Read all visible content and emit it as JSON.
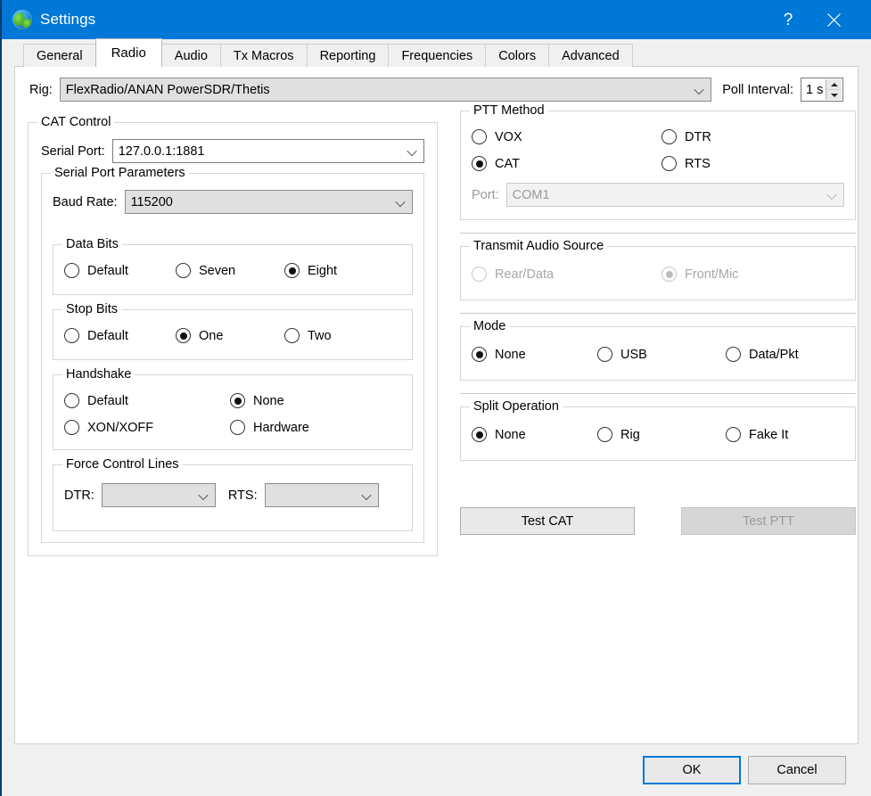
{
  "window": {
    "title": "Settings",
    "icon": "globe-icon",
    "help_label": "?",
    "close_label": "✕",
    "accent_color": "#0078d7"
  },
  "tabs": [
    {
      "label": "General",
      "active": false
    },
    {
      "label": "Radio",
      "active": true
    },
    {
      "label": "Audio",
      "active": false
    },
    {
      "label": "Tx Macros",
      "active": false
    },
    {
      "label": "Reporting",
      "active": false
    },
    {
      "label": "Frequencies",
      "active": false
    },
    {
      "label": "Colors",
      "active": false
    },
    {
      "label": "Advanced",
      "active": false
    }
  ],
  "rig": {
    "label": "Rig:",
    "value": "FlexRadio/ANAN PowerSDR/Thetis",
    "poll_label": "Poll Interval:",
    "poll_value": "1 s"
  },
  "cat_control": {
    "legend": "CAT Control",
    "serial_port": {
      "label": "Serial Port:",
      "value": "127.0.0.1:1881"
    },
    "serial_params": {
      "legend": "Serial Port Parameters",
      "baud_rate": {
        "label": "Baud Rate:",
        "value": "115200"
      }
    },
    "data_bits": {
      "legend": "Data Bits",
      "options": [
        {
          "label": "Default",
          "checked": false
        },
        {
          "label": "Seven",
          "checked": false
        },
        {
          "label": "Eight",
          "checked": true
        }
      ]
    },
    "stop_bits": {
      "legend": "Stop Bits",
      "options": [
        {
          "label": "Default",
          "checked": false
        },
        {
          "label": "One",
          "checked": true
        },
        {
          "label": "Two",
          "checked": false
        }
      ]
    },
    "handshake": {
      "legend": "Handshake",
      "options": [
        {
          "label": "Default",
          "checked": false
        },
        {
          "label": "None",
          "checked": true
        },
        {
          "label": "XON/XOFF",
          "checked": false
        },
        {
          "label": "Hardware",
          "checked": false
        }
      ]
    },
    "force_control_lines": {
      "legend": "Force Control Lines",
      "dtr": {
        "label": "DTR:",
        "value": ""
      },
      "rts": {
        "label": "RTS:",
        "value": ""
      }
    }
  },
  "ptt_method": {
    "legend": "PTT Method",
    "options": [
      {
        "label": "VOX",
        "checked": false
      },
      {
        "label": "DTR",
        "checked": false
      },
      {
        "label": "CAT",
        "checked": true
      },
      {
        "label": "RTS",
        "checked": false
      }
    ],
    "port": {
      "label": "Port:",
      "value": "COM1",
      "enabled": false
    }
  },
  "transmit_audio_source": {
    "legend": "Transmit Audio Source",
    "enabled": false,
    "options": [
      {
        "label": "Rear/Data",
        "checked": false
      },
      {
        "label": "Front/Mic",
        "checked": true
      }
    ]
  },
  "mode": {
    "legend": "Mode",
    "options": [
      {
        "label": "None",
        "checked": true
      },
      {
        "label": "USB",
        "checked": false
      },
      {
        "label": "Data/Pkt",
        "checked": false
      }
    ]
  },
  "split_operation": {
    "legend": "Split Operation",
    "options": [
      {
        "label": "None",
        "checked": true
      },
      {
        "label": "Rig",
        "checked": false
      },
      {
        "label": "Fake It",
        "checked": false
      }
    ]
  },
  "test_buttons": {
    "test_cat": "Test CAT",
    "test_ptt": "Test PTT"
  },
  "footer": {
    "ok": "OK",
    "cancel": "Cancel"
  }
}
